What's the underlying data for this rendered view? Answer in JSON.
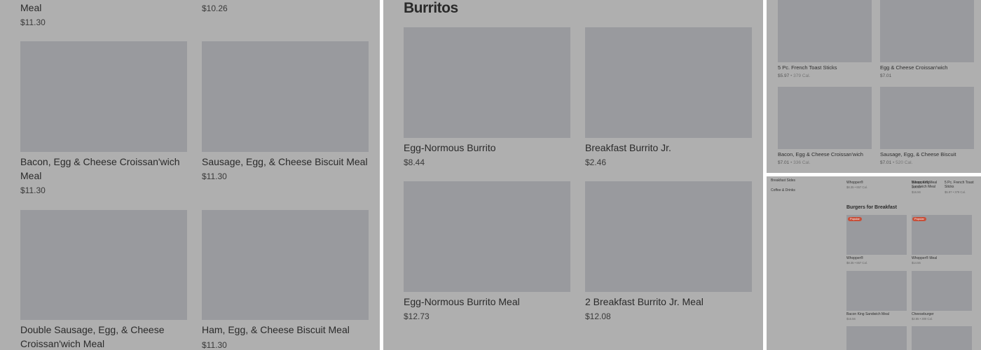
{
  "panel1": {
    "row0": {
      "left_name": "Meal",
      "left_price": "$11.30",
      "right_price": "$10.26"
    },
    "row1": [
      {
        "name": "Bacon, Egg & Cheese Croissan'wich Meal",
        "price": "$11.30"
      },
      {
        "name": "Sausage, Egg, & Cheese Biscuit Meal",
        "price": "$11.30"
      }
    ],
    "row2": [
      {
        "name": "Double Sausage, Egg, & Cheese Croissan'wich Meal",
        "price": ""
      },
      {
        "name": "Ham, Egg, & Cheese Biscuit Meal",
        "price": "$11.30"
      }
    ]
  },
  "panel2": {
    "section_title": "Burritos",
    "items": [
      {
        "name": "Egg-Normous Burrito",
        "price": "$8.44"
      },
      {
        "name": "Breakfast Burrito Jr.",
        "price": "$2.46"
      },
      {
        "name": "Egg-Normous Burrito Meal",
        "price": "$12.73"
      },
      {
        "name": "2 Breakfast Burrito Jr. Meal",
        "price": "$12.08"
      }
    ]
  },
  "panel3": {
    "items": [
      {
        "name": "5 Pc. French Toast Sticks",
        "price": "$5.97",
        "cal": "• 379 Cal."
      },
      {
        "name": "Egg & Cheese Croissan'wich",
        "price": "$7.01",
        "cal": ""
      },
      {
        "name": "Bacon, Egg & Cheese Croissan'wich",
        "price": "$7.01",
        "cal": "• 336 Cal."
      },
      {
        "name": "Sausage, Egg, & Cheese Biscuit",
        "price": "$7.01",
        "cal": "• 520 Cal."
      }
    ]
  },
  "panel4": {
    "sidebar": [
      "Breakfast Sides",
      "Coffee & Drinks"
    ],
    "top_items": [
      {
        "name": "Whopper®",
        "price": "$8.35 • 657 Cal."
      },
      {
        "name": "Whopper® Meal",
        "price": "$14.55"
      },
      {
        "name": "Bacon King Sandwich Meal",
        "price": "$16.56"
      },
      {
        "name": "5 Pc. French Toast Sticks",
        "price": "$5.97 • 379 Cal."
      }
    ],
    "section_title": "Burgers for Breakfast",
    "badge": "Popular",
    "items": [
      {
        "name": "Whopper®",
        "price": "$8.35 • 657 Cal."
      },
      {
        "name": "Whopper® Meal",
        "price": "$14.55"
      },
      {
        "name": "Bacon King Sandwich Meal",
        "price": "$16.56"
      },
      {
        "name": "Cheeseburger",
        "price": "$2.85 • 300 Cal."
      }
    ]
  }
}
